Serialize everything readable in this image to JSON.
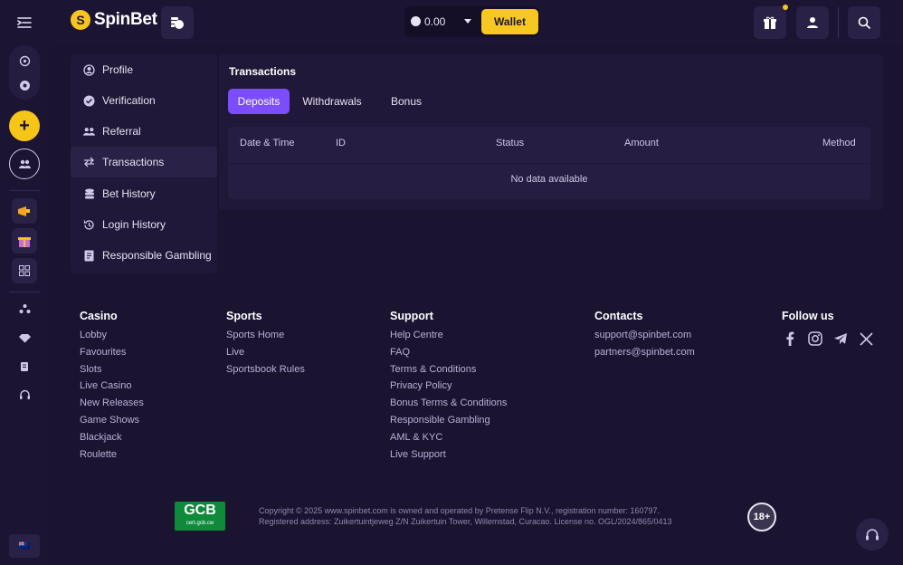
{
  "header": {
    "brand": "SpinBet",
    "logo_glyph": "S",
    "balance": "0.00",
    "wallet_label": "Wallet"
  },
  "rail": {
    "add_glyph": "+",
    "flag_glyph": "🇳🇿"
  },
  "account_menu": {
    "items": [
      {
        "label": "Profile",
        "icon": "user-circle-icon"
      },
      {
        "label": "Verification",
        "icon": "check-circle-icon"
      },
      {
        "label": "Referral",
        "icon": "users-icon"
      },
      {
        "label": "Transactions",
        "icon": "arrows-exchange-icon",
        "active": true
      },
      {
        "label": "Bet History",
        "icon": "coins-stack-icon"
      },
      {
        "label": "Login History",
        "icon": "history-icon"
      },
      {
        "label": "Responsible Gambling",
        "icon": "document-icon"
      }
    ]
  },
  "transactions": {
    "title": "Transactions",
    "tabs": [
      "Deposits",
      "Withdrawals",
      "Bonus"
    ],
    "active_tab": "Deposits",
    "columns": [
      "Date & Time",
      "ID",
      "Status",
      "Amount",
      "Method"
    ],
    "empty_text": "No data available"
  },
  "footer": {
    "casino": {
      "title": "Casino",
      "links": [
        "Lobby",
        "Favourites",
        "Slots",
        "Live Casino",
        "New Releases",
        "Game Shows",
        "Blackjack",
        "Roulette"
      ]
    },
    "sports": {
      "title": "Sports",
      "links": [
        "Sports Home",
        "Live",
        "Sportsbook Rules"
      ]
    },
    "support": {
      "title": "Support",
      "links": [
        "Help Centre",
        "FAQ",
        "Terms & Conditions",
        "Privacy Policy",
        "Bonus Terms & Conditions",
        "Responsible Gambling",
        "AML & KYC",
        "Live Support"
      ]
    },
    "contacts": {
      "title": "Contacts",
      "links": [
        "support@spinbet.com",
        "partners@spinbet.com"
      ]
    },
    "follow": {
      "title": "Follow us",
      "networks": [
        "facebook-icon",
        "instagram-icon",
        "telegram-icon",
        "x-icon"
      ]
    },
    "gcb_title": "GCB",
    "gcb_sub": "cert.gcb.cw",
    "copyright_line1": "Copyright © 2025 www.spinbet.com is owned and operated by Pretense Flip N.V., registration number: 160797.",
    "copyright_line2": "Registered address: Zuikertuintjeweg Z/N Zuikertuin Tower, Willemstad, Curacao. License no. OGL/2024/865/0413",
    "age_label": "18+"
  },
  "colors": {
    "accent": "#f8c822",
    "active_tab": "#7b4dff",
    "background": "#1a1430"
  }
}
